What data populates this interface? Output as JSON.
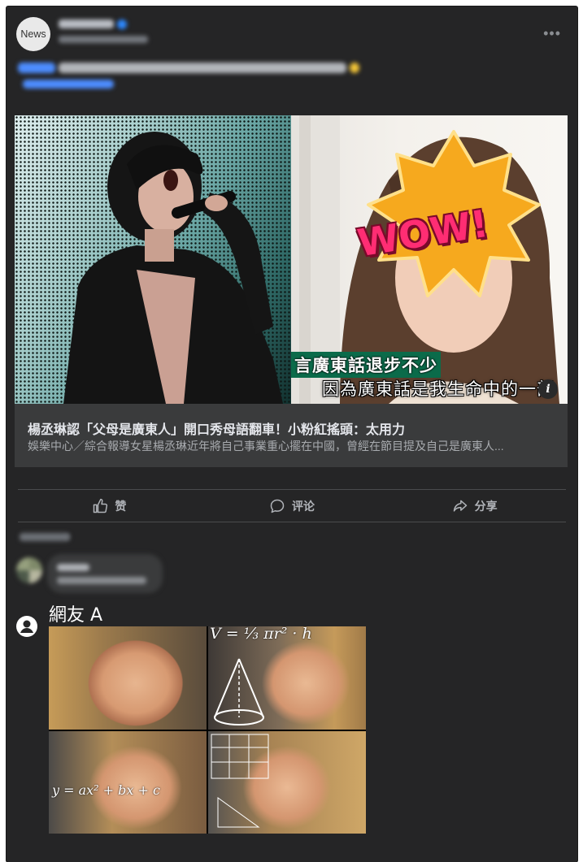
{
  "post": {
    "avatar_label": "News"
  },
  "link_preview": {
    "subtitle_line1": "言廣東話退步不少",
    "subtitle_line2": "因為廣東話是我生命中的一部",
    "sticker_text": "WOW!",
    "info_icon": "i",
    "title": "楊丞琳認「父母是廣東人」開口秀母語翻車！小粉紅搖頭：太用力",
    "description": "娛樂中心／綜合報導女星楊丞琳近年將自己事業重心擺在中國，曾經在節目提及自己是廣東人..."
  },
  "actions": {
    "like_label": "赞",
    "comment_label": "评论",
    "share_label": "分享",
    "icons": [
      "thumbs-up-icon",
      "comment-bubble-icon",
      "share-arrow-icon"
    ]
  },
  "overlay_comment": {
    "author": "網友 A",
    "avatar_icon": "user-icon",
    "meme_formula_top": "V = ⅓ πr² · h",
    "meme_formula_bottom": "y = ax² + bx + c"
  },
  "colors": {
    "card_bg": "#252526",
    "link_box_bg": "#3a3b3c",
    "accent_blue": "#2d88ff"
  }
}
